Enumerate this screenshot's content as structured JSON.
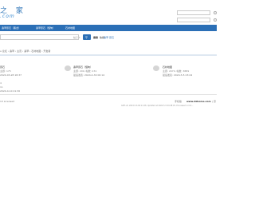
{
  "header": {
    "logo_text": "之 家",
    "logo_sub": ".com",
    "username_label": "用户名",
    "password_label": "密码"
  },
  "nav": {
    "items": [
      "翡翠原石（黑龙）",
      "翡翠原石（缅甸）",
      "石材地图"
    ]
  },
  "search": {
    "placeholder": "",
    "button_label": "搜索",
    "hot_label": "热搜:",
    "hot_items": [
      "翡翠",
      "原石"
    ]
  },
  "breadcrumb": {
    "text": "论坛 › 翡翠 › 主页 › 翡翠 › 石材地图 › 开发者"
  },
  "forums": [
    {
      "name": "原石",
      "meta": "主题: 175",
      "date": "2024-03-28 18:37"
    },
    {
      "name": "翡翠原石（缅甸）",
      "meta": "主题: 209, 帖数: 231",
      "date": "最后发表: 2024-4-30 00:14"
    },
    {
      "name": "石材地图",
      "meta": "主题: 2070, 帖数: 3889",
      "date": "最后发表: 2024-5-5 23:24"
    }
  ],
  "forum_extra": {
    "meta": "4",
    "sub_meta": "11",
    "date": "2024-4-10 21:30"
  },
  "footer": {
    "left": "13 Licensed",
    "right_label": "手机版",
    "site": "www.dzhome.com",
    "right_extra": "| 京",
    "bottom": "GMT+8, 2024-5-6 00:21:28, Updated at 2024-5-5 09:28:45, Processed in 0.0..."
  }
}
